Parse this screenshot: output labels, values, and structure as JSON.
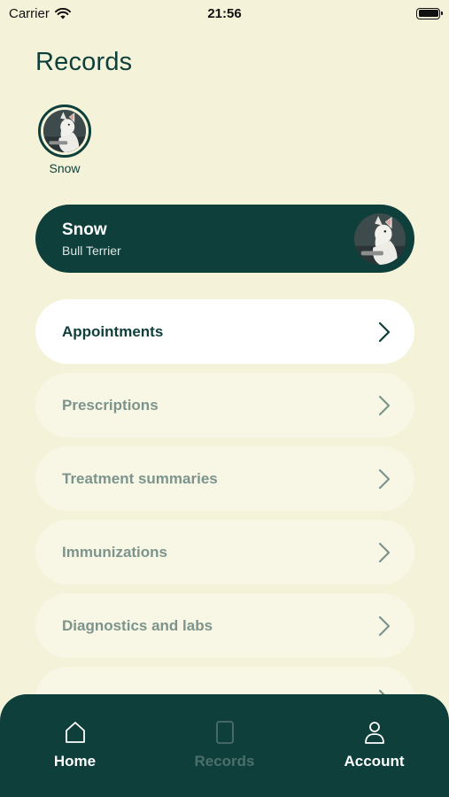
{
  "status_bar": {
    "carrier": "Carrier",
    "time": "21:56"
  },
  "page": {
    "title": "Records"
  },
  "pet_selector": {
    "pets": [
      {
        "name": "Snow"
      }
    ]
  },
  "pet_banner": {
    "name": "Snow",
    "breed": "Bull Terrier"
  },
  "records": [
    {
      "label": "Appointments",
      "active": true
    },
    {
      "label": "Prescriptions",
      "active": false
    },
    {
      "label": "Treatment summaries",
      "active": false
    },
    {
      "label": "Immunizations",
      "active": false
    },
    {
      "label": "Diagnostics and labs",
      "active": false
    }
  ],
  "bottom_nav": {
    "items": [
      {
        "label": "Home",
        "icon": "home-icon"
      },
      {
        "label": "Records",
        "icon": "records-icon"
      },
      {
        "label": "Account",
        "icon": "account-icon"
      }
    ]
  },
  "colors": {
    "background": "#f4f3d9",
    "primary": "#0e3f3b",
    "muted": "#7d948c"
  }
}
